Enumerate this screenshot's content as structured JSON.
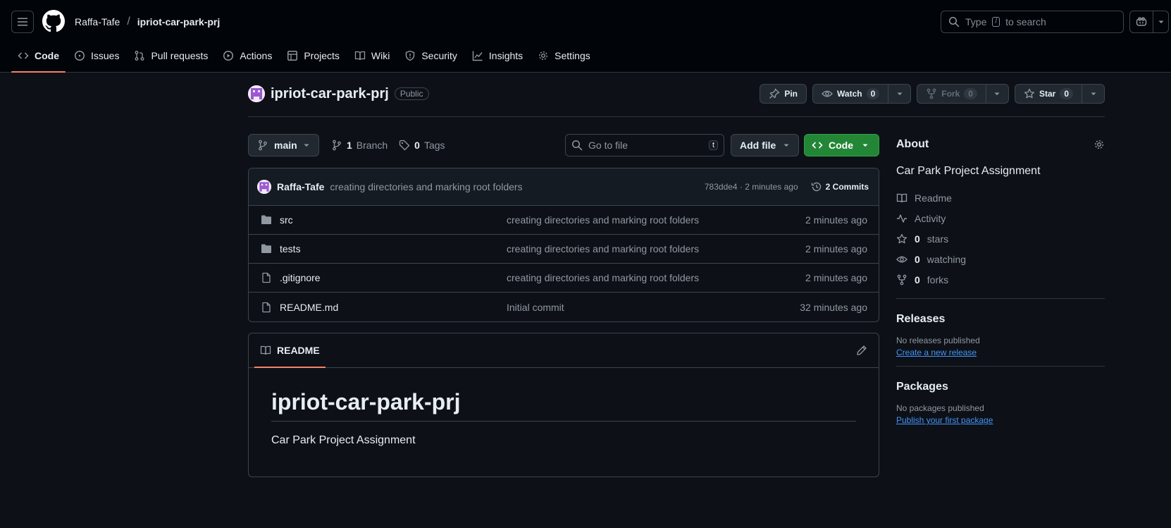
{
  "header": {
    "owner": "Raffa-Tafe",
    "separator": "/",
    "repo": "ipriot-car-park-prj",
    "search_before": "Type",
    "search_key": "/",
    "search_after": "to search"
  },
  "nav": {
    "tabs": [
      {
        "label": "Code",
        "icon": "code-icon"
      },
      {
        "label": "Issues",
        "icon": "issue-icon"
      },
      {
        "label": "Pull requests",
        "icon": "pull-request-icon"
      },
      {
        "label": "Actions",
        "icon": "play-icon"
      },
      {
        "label": "Projects",
        "icon": "table-icon"
      },
      {
        "label": "Wiki",
        "icon": "book-icon"
      },
      {
        "label": "Security",
        "icon": "shield-icon"
      },
      {
        "label": "Insights",
        "icon": "graph-icon"
      },
      {
        "label": "Settings",
        "icon": "gear-icon"
      }
    ]
  },
  "repo": {
    "name": "ipriot-car-park-prj",
    "visibility": "Public",
    "pin_label": "Pin",
    "watch_label": "Watch",
    "watch_count": "0",
    "fork_label": "Fork",
    "fork_count": "0",
    "star_label": "Star",
    "star_count": "0"
  },
  "toolbar": {
    "branch": "main",
    "branch_count": "1",
    "branch_label": "Branch",
    "tag_count": "0",
    "tag_label": "Tags",
    "goto_placeholder": "Go to file",
    "goto_key": "t",
    "add_file": "Add file",
    "code": "Code"
  },
  "commit": {
    "author": "Raffa-Tafe",
    "message": "creating directories and marking root folders",
    "sha_time": "783dde4 · 2 minutes ago",
    "commits": "2 Commits"
  },
  "files": [
    {
      "name": "src",
      "type": "folder",
      "message": "creating directories and marking root folders",
      "time": "2 minutes ago"
    },
    {
      "name": "tests",
      "type": "folder",
      "message": "creating directories and marking root folders",
      "time": "2 minutes ago"
    },
    {
      "name": ".gitignore",
      "type": "file",
      "message": "creating directories and marking root folders",
      "time": "2 minutes ago"
    },
    {
      "name": "README.md",
      "type": "file",
      "message": "Initial commit",
      "time": "32 minutes ago"
    }
  ],
  "readme": {
    "tab": "README",
    "title": "ipriot-car-park-prj",
    "body": "Car Park Project Assignment"
  },
  "about": {
    "heading": "About",
    "description": "Car Park Project Assignment",
    "readme": "Readme",
    "activity": "Activity",
    "stars_count": "0",
    "stars_label": "stars",
    "watching_count": "0",
    "watching_label": "watching",
    "forks_count": "0",
    "forks_label": "forks"
  },
  "releases": {
    "heading": "Releases",
    "empty": "No releases published",
    "link": "Create a new release"
  },
  "packages": {
    "heading": "Packages",
    "empty": "No packages published",
    "link": "Publish your first package"
  },
  "colors": {
    "accent": "#f78166",
    "primary_button": "#238636",
    "link": "#4493f8",
    "background": "#0d1117"
  }
}
